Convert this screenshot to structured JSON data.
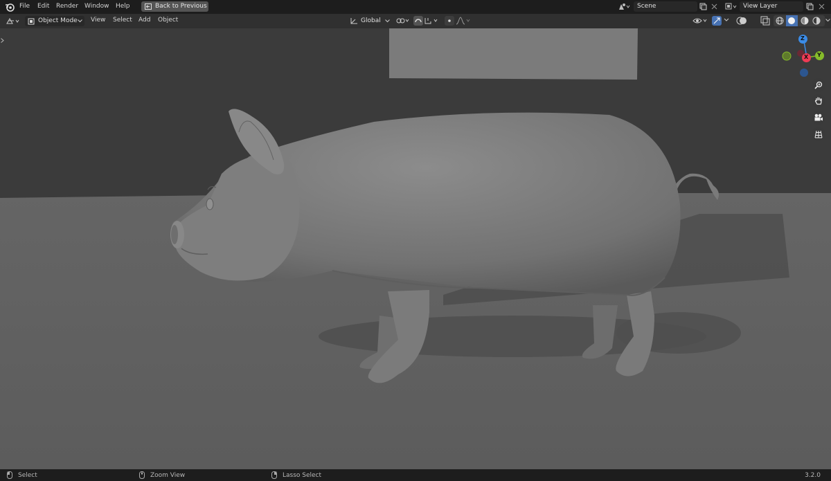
{
  "topbar": {
    "menus": [
      "File",
      "Edit",
      "Render",
      "Window",
      "Help"
    ],
    "back_button": "Back to Previous",
    "scene_value": "Scene",
    "view_layer_value": "View Layer"
  },
  "header": {
    "mode": "Object Mode",
    "menus": [
      "View",
      "Select",
      "Add",
      "Object"
    ],
    "transform_orientation": "Global"
  },
  "gizmo": {
    "z": "Z",
    "y": "Y",
    "x": "X"
  },
  "status": {
    "select": "Select",
    "zoom_view": "Zoom View",
    "lasso_select": "Lasso Select",
    "version": "3.2.0"
  },
  "icons": {
    "blender_logo": "blender-logo-icon",
    "zoom": "zoom-icon",
    "pan": "hand-icon",
    "camera": "camera-icon",
    "grid": "grid-icon"
  },
  "colors": {
    "axis_x": "#ee3b55",
    "axis_y": "#86bc2a",
    "axis_z": "#3b8ce7",
    "active_button": "#4772b3"
  }
}
